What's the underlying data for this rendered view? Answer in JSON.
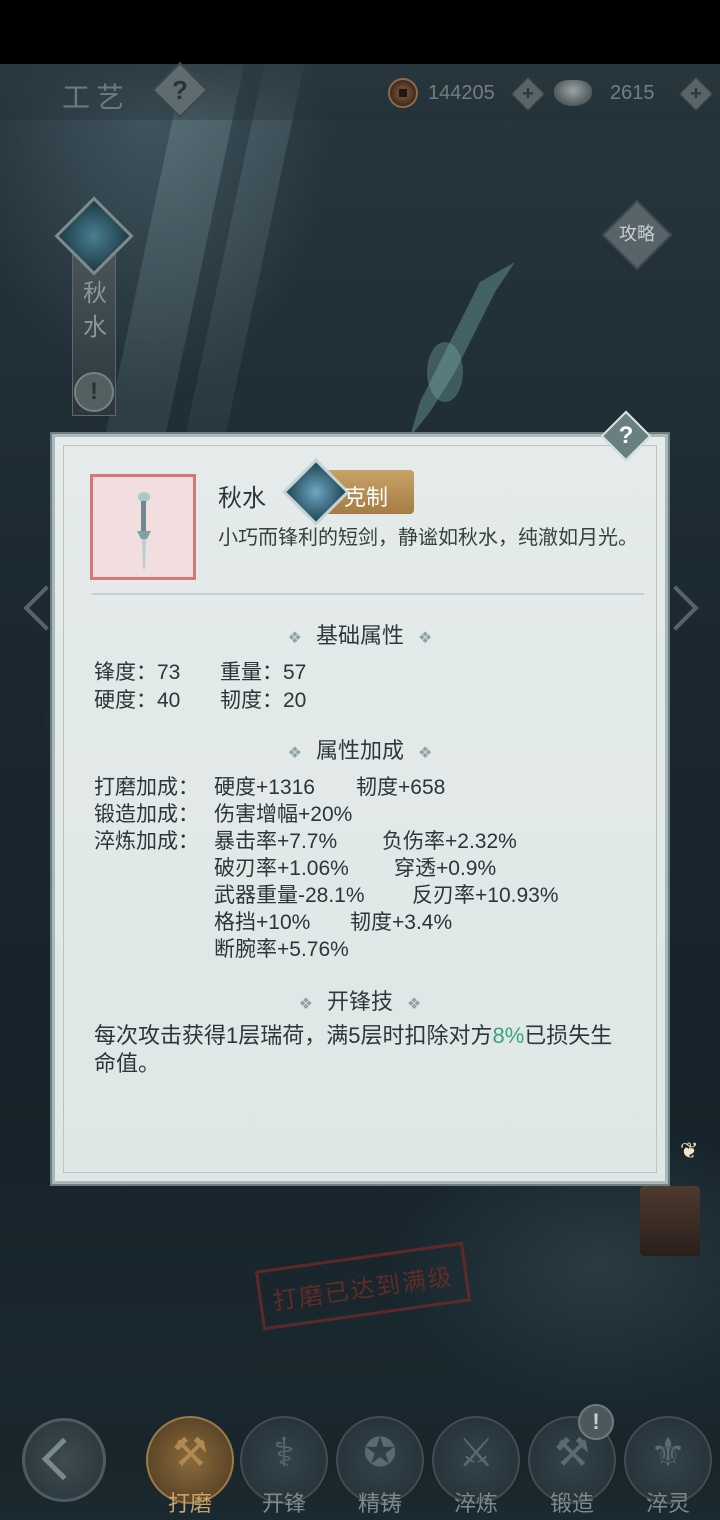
{
  "header": {
    "section_title": "工艺",
    "copper": {
      "icon": "copper-coin-icon",
      "value": "144205"
    },
    "silver": {
      "icon": "silver-ingot-icon",
      "value": "2615"
    }
  },
  "weapon_banner": {
    "name": "秋水"
  },
  "strategy_label": "攻略",
  "item": {
    "name": "秋水",
    "tag": "克制",
    "description": "小巧而锋利的短剑，静谧如秋水，纯澈如月光。"
  },
  "base_attributes": {
    "heading": "基础属性",
    "rows": [
      {
        "a": "锋度：73",
        "b": "重量：57"
      },
      {
        "a": "硬度：40",
        "b": "韧度：20"
      }
    ]
  },
  "bonus_attributes": {
    "heading": "属性加成",
    "polish": {
      "label": "打磨加成：",
      "a": "硬度+1316",
      "b": "韧度+658"
    },
    "forge": {
      "label": "锻造加成：",
      "a": "伤害增幅+20%"
    },
    "temper": {
      "label": "淬炼加成：",
      "rows": [
        {
          "a": "暴击率+7.7%",
          "b": "负伤率+2.32%"
        },
        {
          "a": "破刃率+1.06%",
          "b": "穿透+0.9%"
        },
        {
          "a": "武器重量-28.1%",
          "b": "反刃率+10.93%"
        },
        {
          "a": "格挡+10%",
          "b": "韧度+3.4%"
        },
        {
          "a": "断腕率+5.76%",
          "b": ""
        }
      ]
    }
  },
  "skill": {
    "heading": "开锋技",
    "text_before": "每次攻击获得1层瑞荷，满5层时扣除对方",
    "highlight": "8%",
    "text_after": "已损失生命值。",
    "highlight_color": "#3aa37e"
  },
  "stamp": "打磨已达到满级",
  "nav": {
    "back_icon": "back-chevron-icon",
    "items": [
      {
        "label": "打磨",
        "icon": "polish-icon",
        "active": true
      },
      {
        "label": "开锋",
        "icon": "sharpen-icon",
        "active": false
      },
      {
        "label": "精铸",
        "icon": "refine-cast-icon",
        "active": false
      },
      {
        "label": "淬炼",
        "icon": "temper-icon",
        "active": false
      },
      {
        "label": "锻造",
        "icon": "forge-icon",
        "active": false
      },
      {
        "label": "淬灵",
        "icon": "spirit-temper-icon",
        "active": false
      }
    ]
  }
}
